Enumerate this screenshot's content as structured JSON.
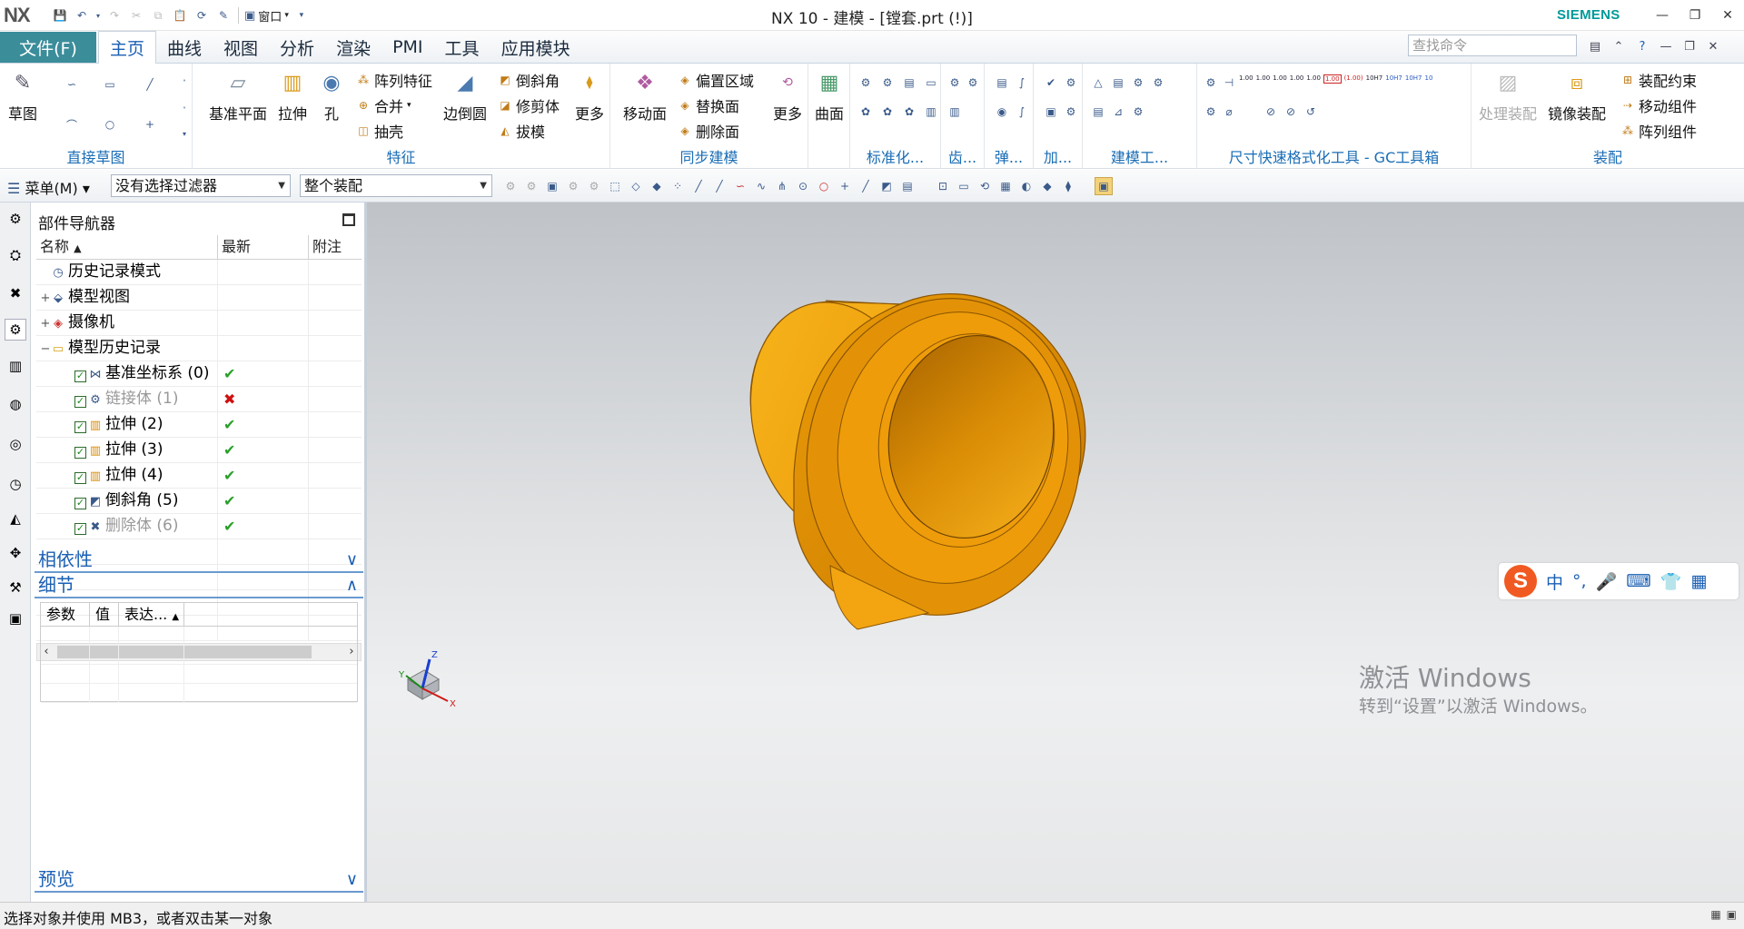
{
  "window": {
    "logo": "NX",
    "title": "NX 10 - 建模 - [镗套.prt   (!)]",
    "brand": "SIEMENS",
    "quick_access": {
      "window_menu": "窗口"
    }
  },
  "tabs": {
    "file": "文件(F)",
    "items": [
      "主页",
      "曲线",
      "视图",
      "分析",
      "渲染",
      "PMI",
      "工具",
      "应用模块"
    ],
    "active": "主页",
    "search_placeholder": "查找命令"
  },
  "ribbon": {
    "direct_sketch": {
      "label": "直接草图",
      "sketch": "草图"
    },
    "feature": {
      "label": "特征",
      "datum_plane": "基准平面",
      "extrude": "拉伸",
      "hole": "孔",
      "pattern_feature": "阵列特征",
      "unite": "合并",
      "shell": "抽壳",
      "edge_blend": "边倒圆",
      "chamfer": "倒斜角",
      "trim_body": "修剪体",
      "draft": "拔模",
      "more": "更多"
    },
    "sync": {
      "label": "同步建模",
      "move_face": "移动面",
      "offset_region": "偏置区域",
      "replace_face": "替换面",
      "delete_face": "删除面",
      "more": "更多"
    },
    "surface": {
      "label": "曲面"
    },
    "standard": {
      "label": "标准化..."
    },
    "gear": {
      "label": "齿..."
    },
    "spring": {
      "label": "弹..."
    },
    "add": {
      "label": "加..."
    },
    "modeling_tools": {
      "label": "建模工..."
    },
    "gc_toolbox": {
      "label": "尺寸快速格式化工具 - GC工具箱",
      "chips": [
        "1.00",
        "1.00",
        "1.00",
        "1.00",
        "1.00",
        "1.00",
        "(1.00)",
        "10H7",
        "10H7",
        "10H7",
        "10"
      ]
    },
    "assembly": {
      "label": "装配",
      "process_assembly": "处理装配",
      "mirror_assembly": "镜像装配",
      "constraint": "装配约束",
      "move_component": "移动组件",
      "pattern_component": "阵列组件"
    }
  },
  "selection_bar": {
    "menu": "菜单(M)",
    "filter": "没有选择过滤器",
    "scope": "整个装配"
  },
  "navigator": {
    "title": "部件导航器",
    "columns": [
      "名称",
      "最新",
      "附注"
    ],
    "rows": [
      {
        "name": "历史记录模式",
        "expand": "",
        "check": false,
        "status": "",
        "dim": false
      },
      {
        "name": "模型视图",
        "expand": "+",
        "check": false,
        "status": "",
        "dim": false
      },
      {
        "name": "摄像机",
        "expand": "+",
        "check": false,
        "status": "",
        "dim": false
      },
      {
        "name": "模型历史记录",
        "expand": "−",
        "check": false,
        "status": "",
        "dim": false
      },
      {
        "name": "基准坐标系 (0)",
        "expand": "",
        "check": true,
        "status": "ok",
        "dim": false
      },
      {
        "name": "链接体 (1)",
        "expand": "",
        "check": true,
        "status": "bad",
        "dim": true
      },
      {
        "name": "拉伸 (2)",
        "expand": "",
        "check": true,
        "status": "ok",
        "dim": false
      },
      {
        "name": "拉伸 (3)",
        "expand": "",
        "check": true,
        "status": "ok",
        "dim": false
      },
      {
        "name": "拉伸 (4)",
        "expand": "",
        "check": true,
        "status": "ok",
        "dim": false
      },
      {
        "name": "倒斜角 (5)",
        "expand": "",
        "check": true,
        "status": "ok",
        "dim": false
      },
      {
        "name": "删除体 (6)",
        "expand": "",
        "check": true,
        "status": "ok",
        "dim": true
      }
    ],
    "sections": {
      "dependencies": "相依性",
      "details": "细节",
      "preview": "预览"
    },
    "detail_columns": [
      "参数",
      "值",
      "表达..."
    ]
  },
  "viewport": {
    "axis": {
      "x": "X",
      "y": "Y",
      "z": "Z"
    },
    "watermark_title": "激活 Windows",
    "watermark_sub": "转到“设置”以激活 Windows。",
    "ime": {
      "logo": "S",
      "items": [
        "中",
        "°,",
        "🎤",
        "⌨",
        "👕",
        "▦"
      ]
    }
  },
  "status": {
    "text": "选择对象并使用 MB3，或者双击某一对象"
  },
  "colors": {
    "accent": "#1a5fb4",
    "file_tab": "#3b8d9a",
    "brand": "#009999",
    "part": "#f2a000"
  }
}
